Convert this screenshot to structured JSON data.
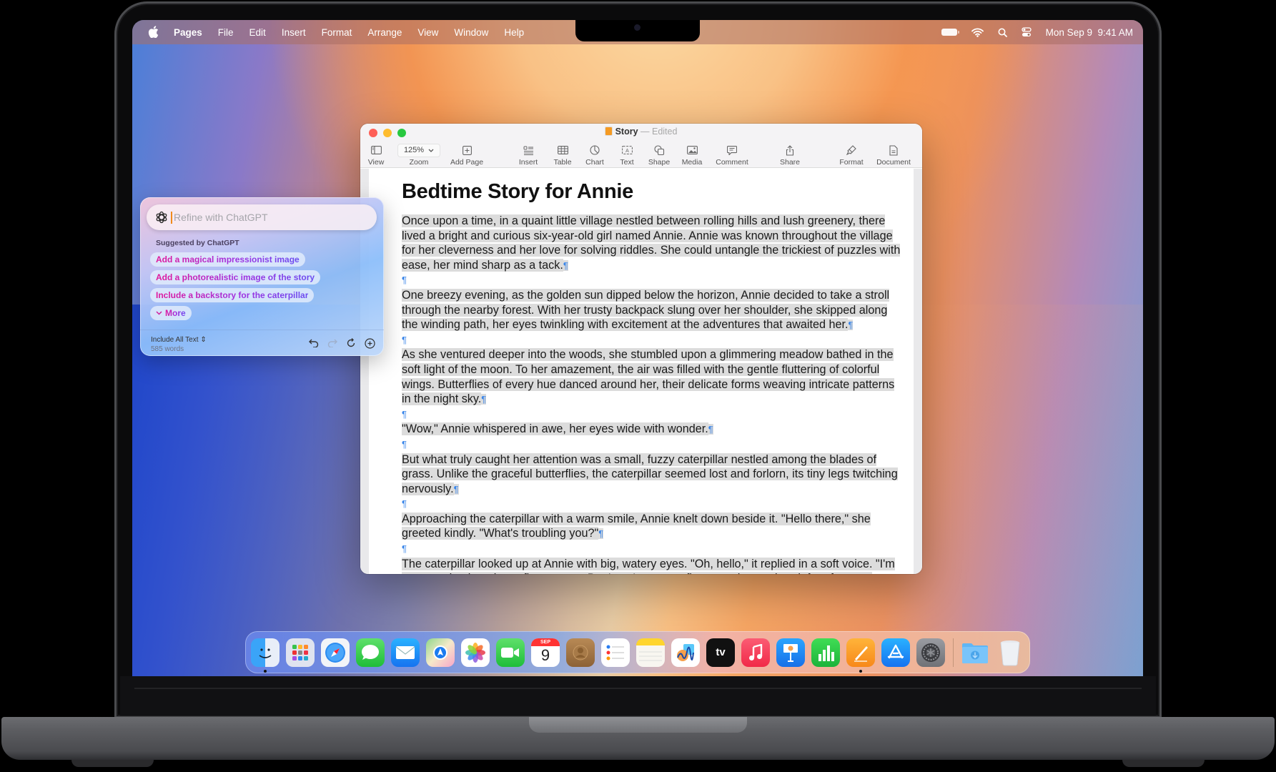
{
  "menubar": {
    "app_name": "Pages",
    "items": [
      "File",
      "Edit",
      "Insert",
      "Format",
      "Arrange",
      "View",
      "Window",
      "Help"
    ],
    "clock": "Mon Sep 9  9:41 AM"
  },
  "window": {
    "title": "Story",
    "title_sep": "—",
    "status": "Edited",
    "toolbar": {
      "view": "View",
      "zoom_value": "125%",
      "zoom": "Zoom",
      "add_page": "Add Page",
      "insert": "Insert",
      "table": "Table",
      "chart": "Chart",
      "text": "Text",
      "shape": "Shape",
      "media": "Media",
      "comment": "Comment",
      "share": "Share",
      "format": "Format",
      "document": "Document"
    },
    "document": {
      "heading": "Bedtime Story for Annie",
      "pilcrow": "¶",
      "paragraphs": [
        "Once upon a time, in a quaint little village nestled between rolling hills and lush greenery, there lived a bright and curious six-year-old girl named Annie. Annie was known throughout the village for her cleverness and her love for solving riddles. She could untangle the trickiest of puzzles with ease, her mind sharp as a tack.",
        "One breezy evening, as the golden sun dipped below the horizon, Annie decided to take a stroll through the nearby forest. With her trusty backpack slung over her shoulder, she skipped along the winding path, her eyes twinkling with excitement at the adventures that awaited her.",
        "As she ventured deeper into the woods, she stumbled upon a glimmering meadow bathed in the soft light of the moon. To her amazement, the air was filled with the gentle fluttering of colorful wings. Butterflies of every hue danced around her, their delicate forms weaving intricate patterns in the night sky.",
        "\"Wow,\" Annie whispered in awe, her eyes wide with wonder.",
        "But what truly caught her attention was a small, fuzzy caterpillar nestled among the blades of grass. Unlike the graceful butterflies, the caterpillar seemed lost and forlorn, its tiny legs twitching nervously.",
        "Approaching the caterpillar with a warm smile, Annie knelt down beside it. \"Hello there,\" she greeted kindly. \"What's troubling you?\"",
        "The caterpillar looked up at Annie with big, watery eyes. \"Oh, hello,\" it replied in a soft voice. \"I'm supposed to be a butterfly, you see. But I can't seem to figure out how to break free from my cocoon.\""
      ]
    }
  },
  "chatgpt_panel": {
    "input_placeholder": "Refine with ChatGPT",
    "input_value": "",
    "suggested_heading": "Suggested by ChatGPT",
    "suggestions": [
      "Add a magical impressionist image",
      "Add a photorealistic image of the story",
      "Include a backstory for the caterpillar"
    ],
    "more_label": "More",
    "scope_label": "Include All Text",
    "word_count": "585 words"
  },
  "dock": {
    "apps": [
      {
        "name": "Finder",
        "icon": "finder-icon",
        "running": true
      },
      {
        "name": "Launchpad",
        "icon": "launchpad-icon"
      },
      {
        "name": "Safari",
        "icon": "safari-icon"
      },
      {
        "name": "Messages",
        "icon": "messages-icon"
      },
      {
        "name": "Mail",
        "icon": "mail-icon"
      },
      {
        "name": "Maps",
        "icon": "maps-icon"
      },
      {
        "name": "Photos",
        "icon": "photos-icon"
      },
      {
        "name": "FaceTime",
        "icon": "facetime-icon"
      },
      {
        "name": "Calendar",
        "icon": "calendar-icon",
        "month": "SEP",
        "day": "9"
      },
      {
        "name": "Contacts",
        "icon": "contacts-icon"
      },
      {
        "name": "Reminders",
        "icon": "reminders-icon"
      },
      {
        "name": "Notes",
        "icon": "notes-icon"
      },
      {
        "name": "Freeform",
        "icon": "freeform-icon"
      },
      {
        "name": "TV",
        "icon": "appletv-icon",
        "label": "tv"
      },
      {
        "name": "Music",
        "icon": "music-icon"
      },
      {
        "name": "Keynote",
        "icon": "keynote-icon"
      },
      {
        "name": "Numbers",
        "icon": "numbers-icon"
      },
      {
        "name": "Pages",
        "icon": "pages-icon",
        "running": true
      },
      {
        "name": "App Store",
        "icon": "appstore-icon"
      },
      {
        "name": "System Settings",
        "icon": "settings-icon"
      },
      {
        "name": "Downloads",
        "icon": "downloads-folder-icon"
      },
      {
        "name": "Trash",
        "icon": "trash-icon"
      }
    ]
  },
  "colors": {
    "accent_pink": "#e0189c",
    "accent_purple": "#6a4cf0",
    "selection": "#dcdcdc",
    "pilcrow": "#3a86ea",
    "close": "#fe5f57",
    "minimize": "#febc2e",
    "zoom": "#28c840"
  }
}
